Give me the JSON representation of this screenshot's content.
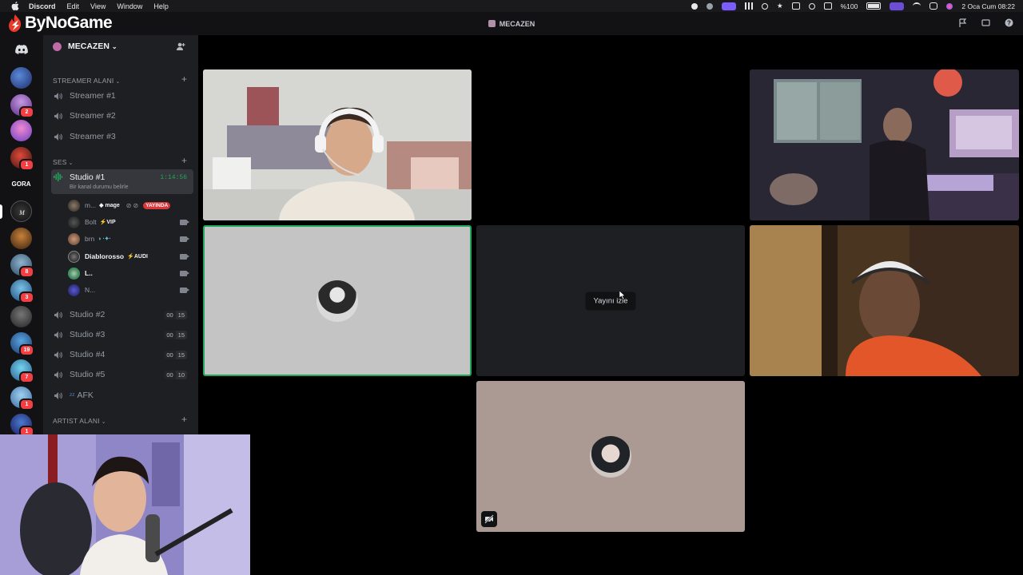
{
  "menubar": {
    "app_name": "Discord",
    "items": [
      "Edit",
      "View",
      "Window",
      "Help"
    ],
    "battery": "%100",
    "datetime": "2 Oca Cum  08:22"
  },
  "titlebar": {
    "brand": "ByNoGame",
    "server_name": "MECAZEN"
  },
  "server": {
    "name": "MECAZEN",
    "icons": [
      "discord-home",
      "server-1",
      "server-2",
      "server-3",
      "server-4",
      "gora",
      "mecazen",
      "server-6",
      "server-7",
      "server-8",
      "server-9",
      "server-10",
      "server-11",
      "server-12",
      "server-13"
    ],
    "gora_label": "GORA",
    "badges": [
      "2",
      "1",
      "8",
      "3",
      "19",
      "7",
      "1",
      "1"
    ]
  },
  "categories": {
    "streamer": "STREAMER ALANI",
    "ses": "SES",
    "artist": "ARTIST ALANI"
  },
  "streamer_channels": [
    "Streamer #1",
    "Streamer #2",
    "Streamer #3"
  ],
  "active_channel": {
    "name": "Studio #1",
    "time": "1:14:56",
    "status": "Bir kanal durumu belirle"
  },
  "users": [
    {
      "name": "m...",
      "tag": "mage",
      "live": "YAYINDA"
    },
    {
      "name": "Bolt",
      "tag": "VIP"
    },
    {
      "name": "brn",
      "tag": ""
    },
    {
      "name": "Diablorosso",
      "tag": "AUDI"
    },
    {
      "name": "L..",
      "tag": ""
    },
    {
      "name": "N...",
      "tag": ""
    }
  ],
  "other_channels": [
    {
      "name": "Studio #2",
      "a": "00",
      "b": "15"
    },
    {
      "name": "Studio #3",
      "a": "00",
      "b": "15"
    },
    {
      "name": "Studio #4",
      "a": "00",
      "b": "15"
    },
    {
      "name": "Studio #5",
      "a": "00",
      "b": "10"
    }
  ],
  "afk_channel": "AFK",
  "stream": {
    "watch_label": "Yayını izle"
  },
  "colors": {
    "accent_green": "#23a55a",
    "live_red": "#da373c",
    "badge_red": "#f23f43",
    "sidebar_bg": "#1e1f22",
    "rail_bg": "#121214"
  }
}
